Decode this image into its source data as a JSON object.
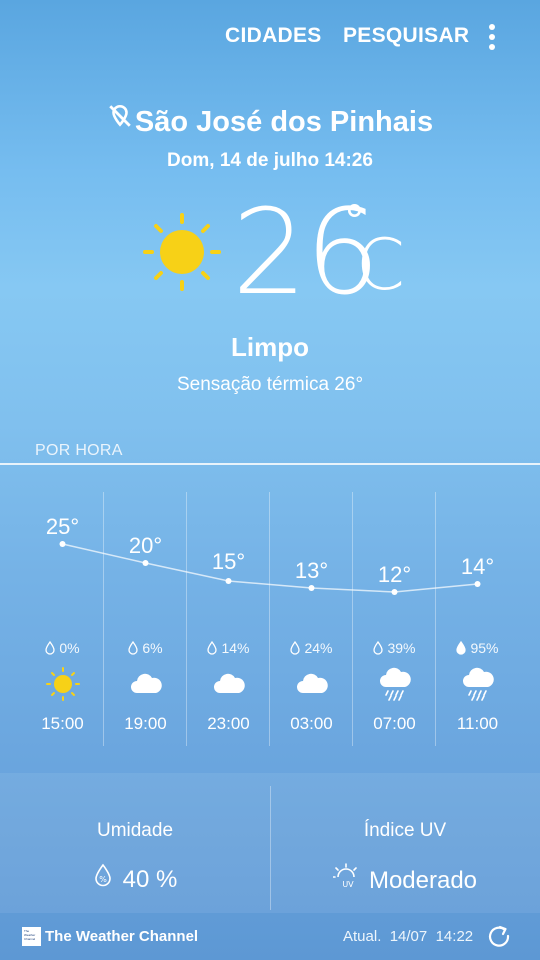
{
  "topbar": {
    "cities_label": "CIDADES",
    "search_label": "PESQUISAR",
    "menu_icon": "more-vert-icon"
  },
  "location": {
    "name": "São José dos Pinhais",
    "icon": "location-off-icon",
    "datetime": "Dom, 14 de julho 14:26"
  },
  "current": {
    "temperature": "26",
    "degree_symbol": "°",
    "unit": "C",
    "condition": "Limpo",
    "feels_like": "Sensação térmica 26°",
    "icon": "sun-icon"
  },
  "hourly": {
    "label": "POR HORA",
    "items": [
      {
        "temp": "25°",
        "precip": "0%",
        "time": "15:00",
        "icon": "sun-icon"
      },
      {
        "temp": "20°",
        "precip": "6%",
        "time": "19:00",
        "icon": "cloud-icon"
      },
      {
        "temp": "15°",
        "precip": "14%",
        "time": "23:00",
        "icon": "cloud-icon"
      },
      {
        "temp": "13°",
        "precip": "24%",
        "time": "03:00",
        "icon": "cloud-icon"
      },
      {
        "temp": "12°",
        "precip": "39%",
        "time": "07:00",
        "icon": "rain-cloud-icon"
      },
      {
        "temp": "14°",
        "precip": "95%",
        "time": "11:00",
        "icon": "rain-cloud-icon"
      }
    ]
  },
  "details": {
    "humidity_label": "Umidade",
    "humidity_value": "40 %",
    "uv_label": "Índice UV",
    "uv_value": "Moderado",
    "uv_icon_text": "UV"
  },
  "footer": {
    "brand": "The Weather Channel",
    "logo_text": "The Weather Channel",
    "updated_label": "Atual.",
    "updated_date": "14/07",
    "updated_time": "14:22"
  },
  "colors": {
    "text": "#ffffff",
    "sun": "#f7d117",
    "sky_top": "#5aa6e0",
    "sky_bottom": "#5d98d4"
  }
}
